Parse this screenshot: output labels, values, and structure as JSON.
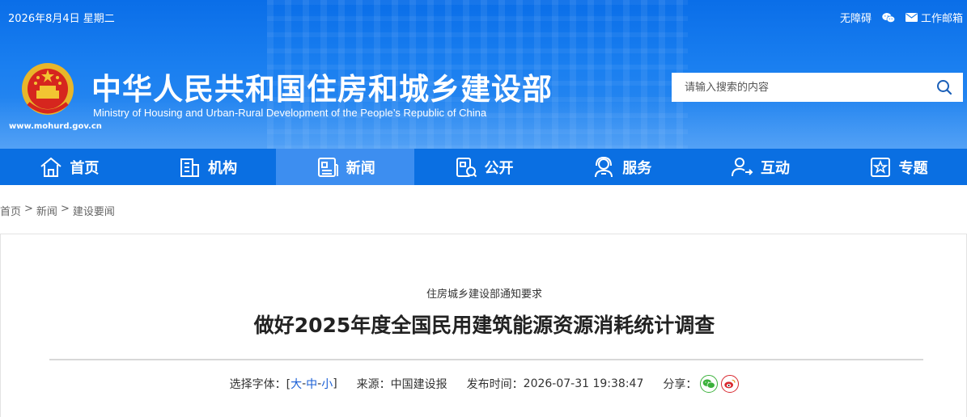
{
  "header": {
    "date": "2026年8月4日 星期二",
    "accessibility_label": "无障碍",
    "mail_label": "工作邮箱",
    "site_url": "www.mohurd.gov.cn",
    "title": "中华人民共和国住房和城乡建设部",
    "subtitle": "Ministry of Housing and Urban-Rural Development of the People’s Republic of China"
  },
  "search": {
    "placeholder": "请输入搜索的内容"
  },
  "nav": {
    "items": [
      {
        "label": "首页",
        "icon": "home-icon"
      },
      {
        "label": "机构",
        "icon": "building-icon"
      },
      {
        "label": "新闻",
        "icon": "news-icon"
      },
      {
        "label": "公开",
        "icon": "disclosure-icon"
      },
      {
        "label": "服务",
        "icon": "service-icon"
      },
      {
        "label": "互动",
        "icon": "interaction-icon"
      },
      {
        "label": "专题",
        "icon": "topic-icon"
      }
    ],
    "active_index": 2
  },
  "breadcrumb": {
    "home": "首页",
    "sep1": ">",
    "news": "新闻",
    "sep2": ">",
    "current": "建设要闻"
  },
  "article": {
    "kicker": "住房城乡建设部通知要求",
    "title": "做好2025年度全国民用建筑能源资源消耗统计调查",
    "font_label": "选择字体：[",
    "font_large": "大",
    "font_sep1": " - ",
    "font_medium": "中",
    "font_sep2": " - ",
    "font_small": "小",
    "font_close": "]",
    "source_label": "来源：",
    "source_value": "中国建设报",
    "publish_label": "发布时间：",
    "publish_value": "2026-07-31 19:38:47",
    "share_label": "分享："
  },
  "colors": {
    "header_blue": "#0a6ee8",
    "nav_blue": "#0a6fe2",
    "nav_active": "#3d8ef0",
    "link_blue": "#1a5fd6",
    "wechat_green": "#3bb13b",
    "weibo_red": "#d8262d"
  }
}
